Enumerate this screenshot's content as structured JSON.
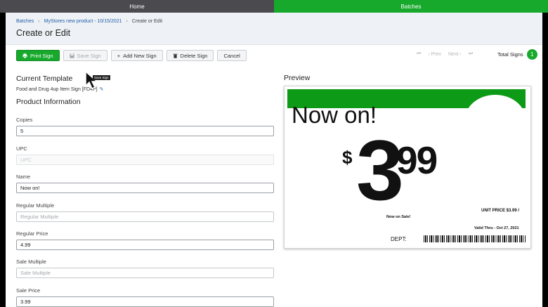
{
  "topnav": {
    "home": "Home",
    "batches": "Batches"
  },
  "breadcrumb": {
    "root": "Batches",
    "batch": "MyStores new product - 10/15/2021",
    "current": "Create or Edit"
  },
  "page": {
    "title": "Create or Edit"
  },
  "toolbar": {
    "print": "Print Sign",
    "save": "Save Sign",
    "add": "Add New Sign",
    "delete": "Delete Sign",
    "cancel": "Cancel"
  },
  "pager": {
    "prev": "Prev",
    "next": "Next"
  },
  "total": {
    "label": "Total Signs",
    "count": "1"
  },
  "template": {
    "heading": "Current Template",
    "name": "Food and Drug 4up Item Sign [FD4P]"
  },
  "product": {
    "heading": "Product Information",
    "fields": {
      "copies": {
        "label": "Copies",
        "value": "5"
      },
      "upc": {
        "label": "UPC",
        "placeholder": "UPC"
      },
      "name": {
        "label": "Name",
        "value": "Now on!"
      },
      "regular_multiple": {
        "label": "Regular Multiple",
        "placeholder": "Regular Multiple"
      },
      "regular_price": {
        "label": "Regular Price",
        "value": "4.99"
      },
      "sale_multiple": {
        "label": "Sale Multiple",
        "placeholder": "Sale Multiple"
      },
      "sale_price": {
        "label": "Sale Price",
        "value": "3.99"
      }
    }
  },
  "preview": {
    "heading": "Preview",
    "headline": "Now on!",
    "dollar": "$",
    "price_main": "3",
    "price_cents": "99",
    "unit_price": "UNIT PRICE $3.99 /",
    "sale_text": "Now on Sale!",
    "valid_thru": "Valid Thru - Oct 27, 2021",
    "dept": "DEPT:"
  },
  "tooltip": "Save Sign",
  "colors": {
    "brand_green": "#17a92c",
    "sign_band": "#0d9a16",
    "link_blue": "#1f5ea8",
    "nav_gray": "#4a4a4f"
  }
}
